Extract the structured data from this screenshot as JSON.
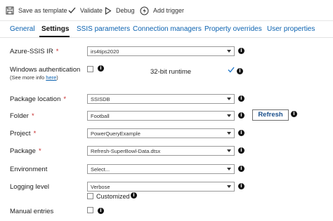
{
  "toolbar": {
    "save_template": "Save as template",
    "validate": "Validate",
    "debug": "Debug",
    "add_trigger": "Add trigger"
  },
  "tabs": [
    {
      "label": "General",
      "active": false
    },
    {
      "label": "Settings",
      "active": true
    },
    {
      "label": "SSIS parameters",
      "active": false
    },
    {
      "label": "Connection managers",
      "active": false
    },
    {
      "label": "Property overrides",
      "active": false
    },
    {
      "label": "User properties",
      "active": false
    }
  ],
  "form": {
    "ir": {
      "label": "Azure-SSIS IR",
      "required": "*",
      "value": "irs4tips2020"
    },
    "windows_auth": {
      "label": "Windows authentication",
      "sub_prefix": "(See more info ",
      "sub_link": "here",
      "sub_suffix": ")",
      "checked": false
    },
    "runtime32": {
      "label": "32-bit runtime",
      "checked": true
    },
    "package_location": {
      "label": "Package location",
      "required": "*",
      "value": "SSISDB"
    },
    "folder": {
      "label": "Folder",
      "required": "*",
      "value": "Football",
      "refresh_label": "Refresh"
    },
    "project": {
      "label": "Project",
      "required": "*",
      "value": "PowerQueryExample"
    },
    "package": {
      "label": "Package",
      "required": "*",
      "value": "Refresh-SuperBowl-Data.dtsx"
    },
    "environment": {
      "label": "Environment",
      "value": "Select..."
    },
    "logging": {
      "label": "Logging level",
      "value": "Verbose",
      "customized_label": "Customized",
      "customized_checked": false
    },
    "manual": {
      "label": "Manual entries",
      "checked": false
    }
  },
  "info_glyph": "i",
  "colors": {
    "link": "#0b62b0",
    "required": "#c62828",
    "check": "#1a73c8"
  }
}
